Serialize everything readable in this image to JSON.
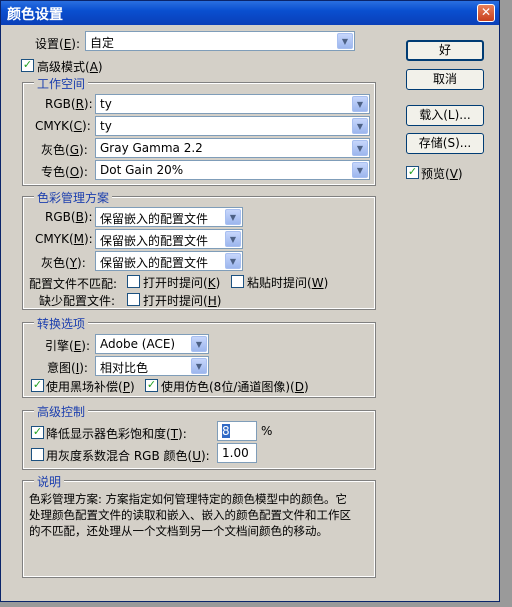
{
  "title": "颜色设置",
  "settings": {
    "label": "设置",
    "key": "E",
    "value": "自定"
  },
  "advanced_mode": {
    "label": "高级模式",
    "key": "A",
    "checked": true
  },
  "working_spaces": {
    "title": "工作空间",
    "rgb": {
      "label": "RGB",
      "key": "R",
      "value": "ty"
    },
    "cmyk": {
      "label": "CMYK",
      "key": "C",
      "value": "ty"
    },
    "gray": {
      "label": "灰色",
      "key": "G",
      "value": "Gray Gamma 2.2"
    },
    "spot": {
      "label": "专色",
      "key": "O",
      "value": "Dot Gain 20%"
    }
  },
  "policies": {
    "title": "色彩管理方案",
    "rgb": {
      "label": "RGB",
      "key": "B",
      "value": "保留嵌入的配置文件"
    },
    "cmyk": {
      "label": "CMYK",
      "key": "M",
      "value": "保留嵌入的配置文件"
    },
    "gray": {
      "label": "灰色",
      "key": "Y",
      "value": "保留嵌入的配置文件"
    },
    "mismatch_label": "配置文件不匹配:",
    "mismatch_open": {
      "label": "打开时提问",
      "key": "K",
      "checked": false
    },
    "mismatch_paste": {
      "label": "粘贴时提问",
      "key": "W",
      "checked": false
    },
    "missing_label": "缺少配置文件:",
    "missing_open": {
      "label": "打开时提问",
      "key": "H",
      "checked": false
    }
  },
  "conversion": {
    "title": "转换选项",
    "engine": {
      "label": "引擎",
      "key": "E",
      "value": "Adobe (ACE)"
    },
    "intent": {
      "label": "意图",
      "key": "I",
      "value": "相对比色"
    },
    "bpc": {
      "label": "使用黑场补偿",
      "key": "P",
      "checked": true
    },
    "dither": {
      "label": "使用仿色(8位/通道图像)",
      "key": "D",
      "checked": true
    }
  },
  "advanced": {
    "title": "高级控制",
    "desaturate": {
      "label": "降低显示器色彩饱和度",
      "key": "T",
      "checked": true,
      "value": "8",
      "unit": "%"
    },
    "blend": {
      "label": "用灰度系数混合 RGB 颜色",
      "key": "U",
      "checked": false,
      "value": "1.00"
    }
  },
  "description": {
    "title": "说明",
    "lines": [
      "色彩管理方案: 方案指定如何管理特定的颜色模型中的颜色。它",
      "处理颜色配置文件的读取和嵌入、嵌入的颜色配置文件和工作区",
      "的不匹配，还处理从一个文档到另一个文档间颜色的移动。"
    ]
  },
  "buttons": {
    "ok": "好",
    "cancel": "取消",
    "load": "载入(L)...",
    "save": "存储(S)...",
    "preview": {
      "label": "预览",
      "key": "V",
      "checked": true
    }
  },
  "icons": {
    "close": "✕",
    "arrow": "▼",
    "check": "✓"
  }
}
